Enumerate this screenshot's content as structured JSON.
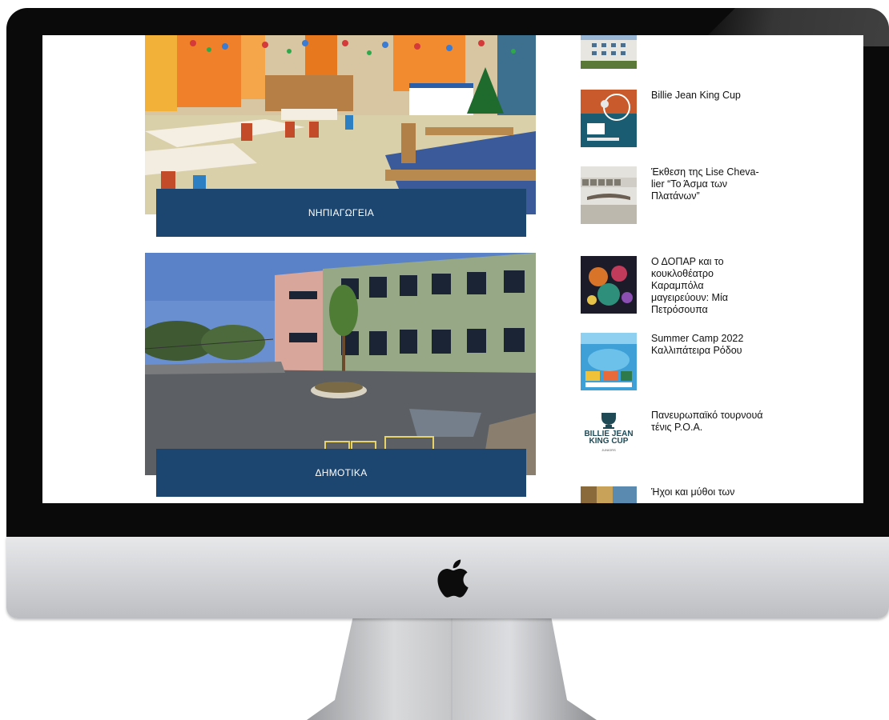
{
  "colors": {
    "label_bg": "#1c4670",
    "label_text": "#ffffff",
    "bezel": "#0a0a0a",
    "chin": "#d4d6d9",
    "news_text": "#111111"
  },
  "device": {
    "logo_icon": "apple-logo-icon"
  },
  "main": {
    "sections": [
      {
        "label": "ΝΗΠΙΑΓΩΓΕΙΑ",
        "image": "kindergarten-classroom-photo"
      },
      {
        "label": "ΔΗΜΟΤΙΚΑ",
        "image": "primary-school-building-photo"
      }
    ]
  },
  "sidebar": {
    "news": [
      {
        "title": "",
        "thumb": "school-building-thumbnail"
      },
      {
        "title": "Billie Jean King Cup",
        "thumb": "tennis-cup-poster-thumbnail"
      },
      {
        "title": "Έκθεση της Lise Cheva-lier “Το Άσμα των Πλατάνων”",
        "thumb": "art-exhibition-thumbnail"
      },
      {
        "title": "Ο ΔΟΠΑΡ και το κουκλοθέατρο Καραμπόλα μαγειρεύουν: Μία Πετρόσουπα",
        "thumb": "puppet-theatre-poster-thumbnail"
      },
      {
        "title": "Summer Camp 2022 Καλλιπάτειρα Ρόδου",
        "thumb": "summer-camp-poster-thumbnail"
      },
      {
        "title": "Πανευρωπαϊκό τουρνουά τένις Ρ.Ο.Α.",
        "thumb": "billie-jean-king-cup-logo-thumbnail"
      },
      {
        "title": "Ήχοι και μύθοι των",
        "thumb": "street-photo-thumbnail"
      }
    ],
    "bjk_logo_text": "BILLIE JEAN KING CUP",
    "bjk_logo_sub": "JUNIORS"
  }
}
